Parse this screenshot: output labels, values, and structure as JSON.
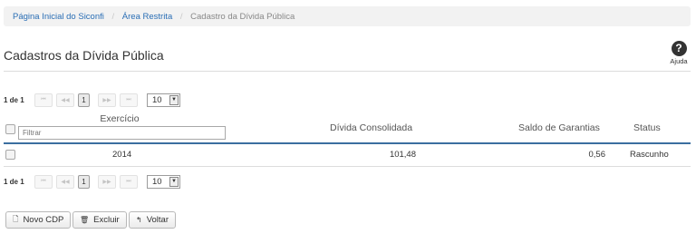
{
  "breadcrumb": {
    "home": "Página Inicial do Siconfi",
    "restricted": "Área Restrita",
    "current": "Cadastro da Dívida Pública"
  },
  "page": {
    "title": "Cadastros da Dívida Pública",
    "help_label": "Ajuda",
    "help_symbol": "?"
  },
  "pager": {
    "count": "1 de 1",
    "first": "⏮",
    "prev": "◀◀",
    "page": "1",
    "next": "▶▶",
    "last": "⏭",
    "page_size": "10"
  },
  "table": {
    "headers": {
      "exercicio": "Exercício",
      "divida": "Dívida Consolidada",
      "saldo": "Saldo de Garantias",
      "status": "Status"
    },
    "filter_placeholder": "Filtrar",
    "rows": [
      {
        "exercicio": "2014",
        "divida": "101,48",
        "saldo": "0,56",
        "status": "Rascunho"
      }
    ]
  },
  "actions": {
    "novo": "Novo CDP",
    "excluir": "Excluir",
    "voltar": "Voltar"
  },
  "colors": {
    "link": "#2a6eb5",
    "header_rule": "#3b6fa0",
    "breadcrumb_bg": "#f2f2f2"
  }
}
